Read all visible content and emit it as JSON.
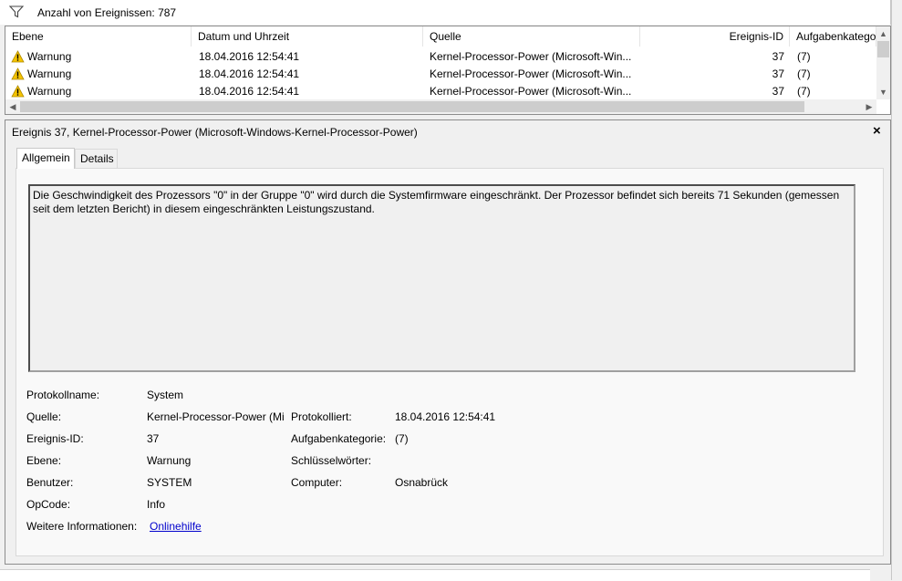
{
  "filter": {
    "icon": "filter-icon",
    "label": "Anzahl von Ereignissen: 787"
  },
  "list": {
    "columns": [
      "Ebene",
      "Datum und Uhrzeit",
      "Quelle",
      "Ereignis-ID",
      "Aufgabenkategorie"
    ],
    "rows": [
      {
        "level": "Warnung",
        "date": "18.04.2016 12:54:41",
        "source": "Kernel-Processor-Power (Microsoft-Win...",
        "id": "37",
        "category": "(7)"
      },
      {
        "level": "Warnung",
        "date": "18.04.2016 12:54:41",
        "source": "Kernel-Processor-Power (Microsoft-Win...",
        "id": "37",
        "category": "(7)"
      },
      {
        "level": "Warnung",
        "date": "18.04.2016 12:54:41",
        "source": "Kernel-Processor-Power (Microsoft-Win...",
        "id": "37",
        "category": "(7)"
      }
    ],
    "warning_icon": "warning-icon",
    "warning_color": "#f5c400"
  },
  "detail": {
    "title": "Ereignis 37, Kernel-Processor-Power (Microsoft-Windows-Kernel-Processor-Power)",
    "close": "×",
    "tabs": [
      "Allgemein",
      "Details"
    ],
    "message": "Die Geschwindigkeit des Prozessors \"0\" in der Gruppe \"0\" wird durch die Systemfirmware eingeschränkt. Der Prozessor befindet sich bereits 71 Sekunden (gemessen seit dem letzten Bericht) in diesem eingeschränkten Leistungszustand.",
    "fields": {
      "protokollname_label": "Protokollname:",
      "protokollname_value": "System",
      "quelle_label": "Quelle:",
      "quelle_value": "Kernel-Processor-Power (Mi",
      "protokolliert_label": "Protokolliert:",
      "protokolliert_value": "18.04.2016 12:54:41",
      "ereignisid_label": "Ereignis-ID:",
      "ereignisid_value": "37",
      "aufgabenkategorie_label": "Aufgabenkategorie:",
      "aufgabenkategorie_value": "(7)",
      "ebene_label": "Ebene:",
      "ebene_value": "Warnung",
      "schluesselwoerter_label": "Schlüsselwörter:",
      "schluesselwoerter_value": "",
      "benutzer_label": "Benutzer:",
      "benutzer_value": "SYSTEM",
      "computer_label": "Computer:",
      "computer_value": "Osnabrück",
      "opcode_label": "OpCode:",
      "opcode_value": "Info",
      "weitere_label": "Weitere Informationen:",
      "weitere_link": "Onlinehilfe"
    }
  }
}
